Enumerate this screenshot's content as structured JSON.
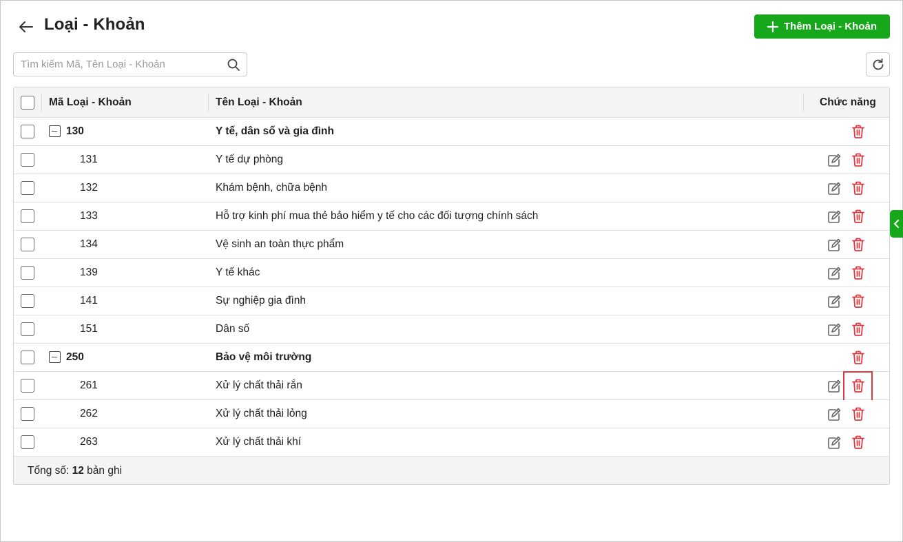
{
  "header": {
    "title": "Loại - Khoản",
    "add_label": "Thêm Loại - Khoản"
  },
  "search": {
    "placeholder": "Tìm kiếm Mã, Tên Loại - Khoản",
    "value": ""
  },
  "table": {
    "columns": {
      "code": "Mã Loại - Khoản",
      "name": "Tên Loại - Khoản",
      "actions": "Chức năng"
    },
    "rows": [
      {
        "code": "130",
        "name": "Y tế, dân số và gia đình",
        "group": true
      },
      {
        "code": "131",
        "name": "Y tế dự phòng",
        "group": false
      },
      {
        "code": "132",
        "name": "Khám bệnh, chữa bệnh",
        "group": false
      },
      {
        "code": "133",
        "name": "Hỗ trợ kinh phí mua thẻ bảo hiểm y tế cho các đối tượng chính sách",
        "group": false
      },
      {
        "code": "134",
        "name": "Vệ sinh an toàn thực phẩm",
        "group": false
      },
      {
        "code": "139",
        "name": "Y tế khác",
        "group": false
      },
      {
        "code": "141",
        "name": "Sự nghiệp gia đình",
        "group": false
      },
      {
        "code": "151",
        "name": "Dân số",
        "group": false
      },
      {
        "code": "250",
        "name": "Bảo vệ môi trường",
        "group": true
      },
      {
        "code": "261",
        "name": "Xử lý chất thải rắn",
        "group": false,
        "highlight_delete": true
      },
      {
        "code": "262",
        "name": "Xử lý chất thải lỏng",
        "group": false
      },
      {
        "code": "263",
        "name": "Xử lý chất thải khí",
        "group": false
      }
    ]
  },
  "footer": {
    "total_prefix": "Tổng số: ",
    "total_count": "12",
    "total_suffix": " bản ghi"
  },
  "colors": {
    "accent": "#17a71b",
    "delete": "#e0383e",
    "edit": "#666666"
  },
  "icons": [
    "back-arrow-icon",
    "plus-icon",
    "search-icon",
    "refresh-icon",
    "collapse-icon",
    "edit-icon",
    "trash-icon",
    "chevron-left-icon"
  ]
}
